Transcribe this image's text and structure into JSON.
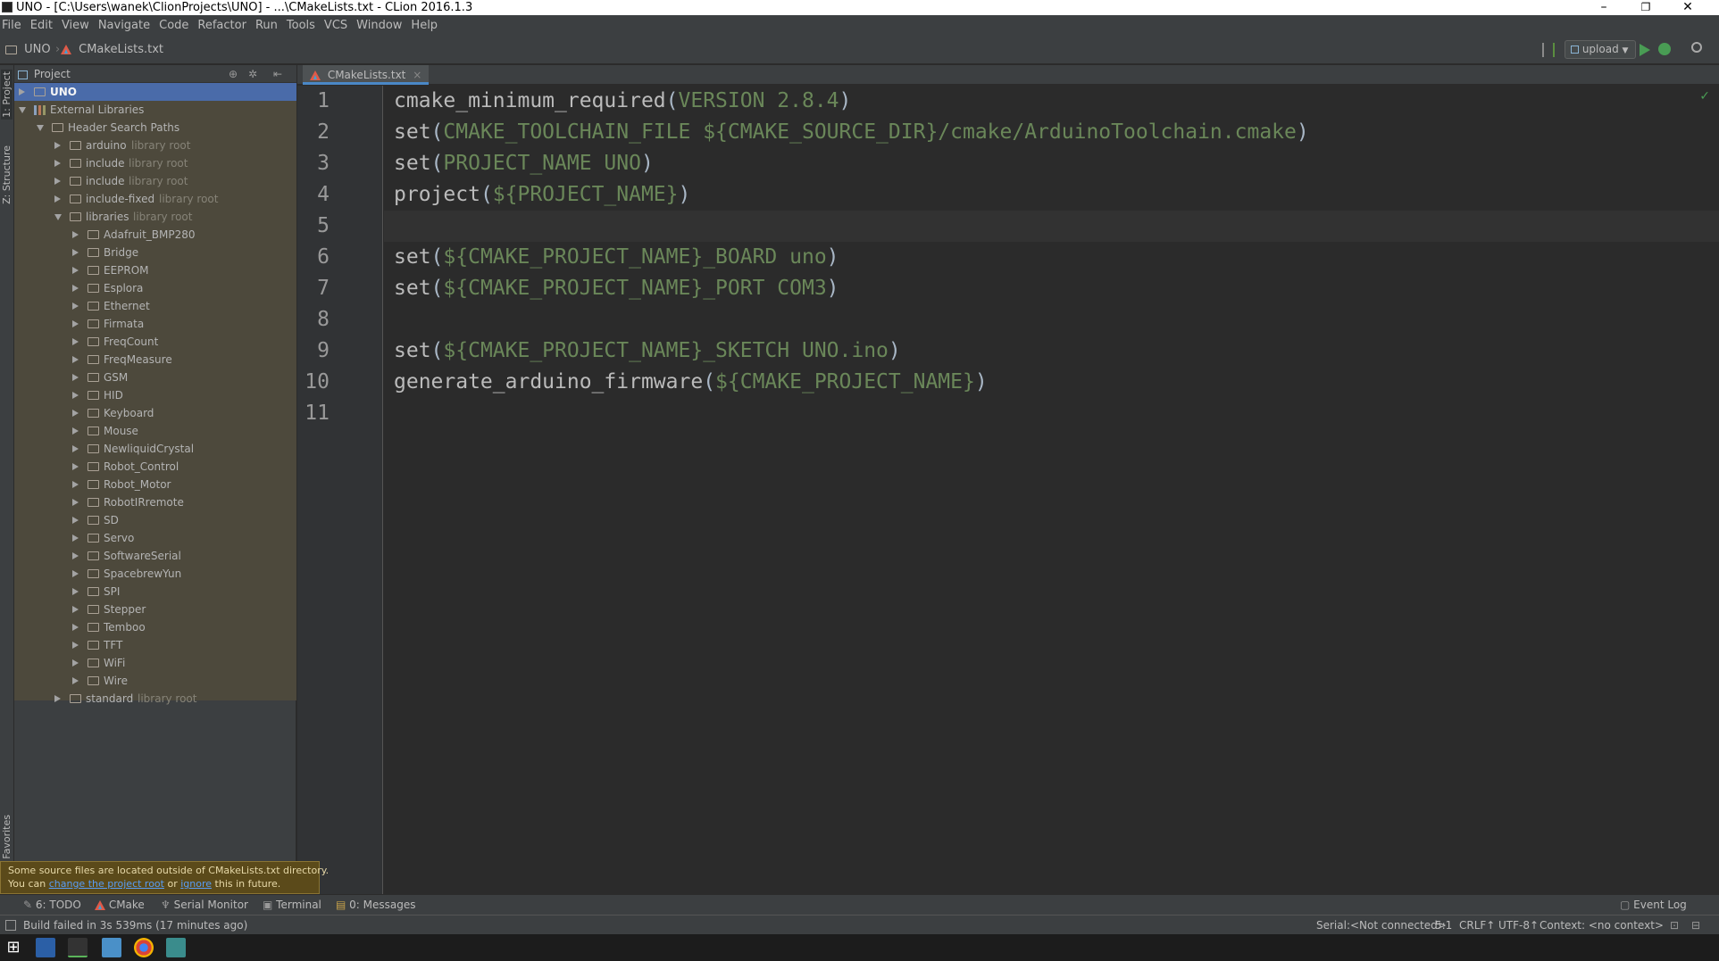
{
  "window": {
    "title": "UNO - [C:\\Users\\wanek\\ClionProjects\\UNO] - ...\\CMakeLists.txt - CLion 2016.1.3",
    "minimize": "–",
    "restore": "❐",
    "close": "✕"
  },
  "menu": [
    "File",
    "Edit",
    "View",
    "Navigate",
    "Code",
    "Refactor",
    "Run",
    "Tools",
    "VCS",
    "Window",
    "Help"
  ],
  "breadcrumb": {
    "project": "UNO",
    "file": "CMakeLists.txt"
  },
  "toolbar": {
    "run_config": "upload"
  },
  "left_strip": {
    "project": "1: Project",
    "structure": "Z: Structure",
    "favorites": "Favorites"
  },
  "project_panel": {
    "title": "Project",
    "tree": [
      {
        "label": "UNO",
        "sub": "",
        "indent": 0,
        "expand": "right",
        "icon": "folder",
        "selected": true
      },
      {
        "label": "External Libraries",
        "sub": "",
        "indent": 0,
        "expand": "down",
        "icon": "libs"
      },
      {
        "label": "Header Search Paths",
        "sub": "",
        "indent": 1,
        "expand": "down",
        "icon": "folder"
      },
      {
        "label": "arduino",
        "sub": "library root",
        "indent": 2,
        "expand": "right",
        "icon": "folder"
      },
      {
        "label": "include",
        "sub": "library root",
        "indent": 2,
        "expand": "right",
        "icon": "folder"
      },
      {
        "label": "include",
        "sub": "library root",
        "indent": 2,
        "expand": "right",
        "icon": "folder"
      },
      {
        "label": "include-fixed",
        "sub": "library root",
        "indent": 2,
        "expand": "right",
        "icon": "folder"
      },
      {
        "label": "libraries",
        "sub": "library root",
        "indent": 2,
        "expand": "down",
        "icon": "folder"
      },
      {
        "label": "Adafruit_BMP280",
        "sub": "",
        "indent": 3,
        "expand": "right",
        "icon": "folder"
      },
      {
        "label": "Bridge",
        "sub": "",
        "indent": 3,
        "expand": "right",
        "icon": "folder"
      },
      {
        "label": "EEPROM",
        "sub": "",
        "indent": 3,
        "expand": "right",
        "icon": "folder"
      },
      {
        "label": "Esplora",
        "sub": "",
        "indent": 3,
        "expand": "right",
        "icon": "folder"
      },
      {
        "label": "Ethernet",
        "sub": "",
        "indent": 3,
        "expand": "right",
        "icon": "folder"
      },
      {
        "label": "Firmata",
        "sub": "",
        "indent": 3,
        "expand": "right",
        "icon": "folder"
      },
      {
        "label": "FreqCount",
        "sub": "",
        "indent": 3,
        "expand": "right",
        "icon": "folder"
      },
      {
        "label": "FreqMeasure",
        "sub": "",
        "indent": 3,
        "expand": "right",
        "icon": "folder"
      },
      {
        "label": "GSM",
        "sub": "",
        "indent": 3,
        "expand": "right",
        "icon": "folder"
      },
      {
        "label": "HID",
        "sub": "",
        "indent": 3,
        "expand": "right",
        "icon": "folder"
      },
      {
        "label": "Keyboard",
        "sub": "",
        "indent": 3,
        "expand": "right",
        "icon": "folder"
      },
      {
        "label": "Mouse",
        "sub": "",
        "indent": 3,
        "expand": "right",
        "icon": "folder"
      },
      {
        "label": "NewliquidCrystal",
        "sub": "",
        "indent": 3,
        "expand": "right",
        "icon": "folder"
      },
      {
        "label": "Robot_Control",
        "sub": "",
        "indent": 3,
        "expand": "right",
        "icon": "folder"
      },
      {
        "label": "Robot_Motor",
        "sub": "",
        "indent": 3,
        "expand": "right",
        "icon": "folder"
      },
      {
        "label": "RobotIRremote",
        "sub": "",
        "indent": 3,
        "expand": "right",
        "icon": "folder"
      },
      {
        "label": "SD",
        "sub": "",
        "indent": 3,
        "expand": "right",
        "icon": "folder"
      },
      {
        "label": "Servo",
        "sub": "",
        "indent": 3,
        "expand": "right",
        "icon": "folder"
      },
      {
        "label": "SoftwareSerial",
        "sub": "",
        "indent": 3,
        "expand": "right",
        "icon": "folder"
      },
      {
        "label": "SpacebrewYun",
        "sub": "",
        "indent": 3,
        "expand": "right",
        "icon": "folder"
      },
      {
        "label": "SPI",
        "sub": "",
        "indent": 3,
        "expand": "right",
        "icon": "folder"
      },
      {
        "label": "Stepper",
        "sub": "",
        "indent": 3,
        "expand": "right",
        "icon": "folder"
      },
      {
        "label": "Temboo",
        "sub": "",
        "indent": 3,
        "expand": "right",
        "icon": "folder"
      },
      {
        "label": "TFT",
        "sub": "",
        "indent": 3,
        "expand": "right",
        "icon": "folder"
      },
      {
        "label": "WiFi",
        "sub": "",
        "indent": 3,
        "expand": "right",
        "icon": "folder"
      },
      {
        "label": "Wire",
        "sub": "",
        "indent": 3,
        "expand": "right",
        "icon": "folder"
      },
      {
        "label": "standard",
        "sub": "library root",
        "indent": 2,
        "expand": "right",
        "icon": "folder"
      }
    ]
  },
  "editor": {
    "tab": "CMakeLists.txt",
    "tab_close": "×",
    "current_line": 5,
    "lines": [
      {
        "n": "1",
        "parts": [
          [
            "cmd",
            "cmake_minimum_required"
          ],
          [
            "p",
            "("
          ],
          [
            "arg",
            "VERSION 2.8.4"
          ],
          [
            "p",
            ")"
          ]
        ]
      },
      {
        "n": "2",
        "parts": [
          [
            "cmd",
            "set"
          ],
          [
            "p",
            "("
          ],
          [
            "arg",
            "CMAKE_TOOLCHAIN_FILE ${CMAKE_SOURCE_DIR}/cmake/ArduinoToolchain.cmake"
          ],
          [
            "p",
            ")"
          ]
        ]
      },
      {
        "n": "3",
        "parts": [
          [
            "cmd",
            "set"
          ],
          [
            "p",
            "("
          ],
          [
            "arg",
            "PROJECT_NAME UNO"
          ],
          [
            "p",
            ")"
          ]
        ]
      },
      {
        "n": "4",
        "parts": [
          [
            "cmd",
            "project"
          ],
          [
            "p",
            "("
          ],
          [
            "arg",
            "${PROJECT_NAME}"
          ],
          [
            "p",
            ")"
          ]
        ]
      },
      {
        "n": "5",
        "parts": []
      },
      {
        "n": "6",
        "parts": [
          [
            "cmd",
            "set"
          ],
          [
            "p",
            "("
          ],
          [
            "arg",
            "${CMAKE_PROJECT_NAME}_BOARD uno"
          ],
          [
            "p",
            ")"
          ]
        ]
      },
      {
        "n": "7",
        "parts": [
          [
            "cmd",
            "set"
          ],
          [
            "p",
            "("
          ],
          [
            "arg",
            "${CMAKE_PROJECT_NAME}_PORT COM3"
          ],
          [
            "p",
            ")"
          ]
        ]
      },
      {
        "n": "8",
        "parts": []
      },
      {
        "n": "9",
        "parts": [
          [
            "cmd",
            "set"
          ],
          [
            "p",
            "("
          ],
          [
            "arg",
            "${CMAKE_PROJECT_NAME}_SKETCH UNO.ino"
          ],
          [
            "p",
            ")"
          ]
        ]
      },
      {
        "n": "10",
        "parts": [
          [
            "cmd",
            "generate_arduino_firmware"
          ],
          [
            "p",
            "("
          ],
          [
            "arg",
            "${CMAKE_PROJECT_NAME}"
          ],
          [
            "p",
            ")"
          ]
        ]
      },
      {
        "n": "11",
        "parts": []
      }
    ]
  },
  "notification": {
    "line1": "Some source files are located outside of CMakeLists.txt directory.",
    "you_can": "You can ",
    "link1": "change the project root",
    "or": " or ",
    "link2": "ignore",
    "tail": " this in future."
  },
  "bottom_tools": {
    "todo": "6: TODO",
    "cmake": "CMake",
    "serial": "Serial Monitor",
    "terminal": "Terminal",
    "messages": "0: Messages",
    "event_log": "Event Log"
  },
  "status": {
    "message": "Build failed in 3s 539ms (17 minutes ago)",
    "serial": "Serial:<Not connected>",
    "position": "5:1",
    "line_sep": "CRLF↑",
    "encoding": "UTF-8↑",
    "context": "Context: <no context>"
  },
  "colors": {
    "accent": "#4b6eaf",
    "keyword": "#bbbbbb",
    "argument": "#6a8759",
    "editor_bg": "#2b2b2b"
  }
}
